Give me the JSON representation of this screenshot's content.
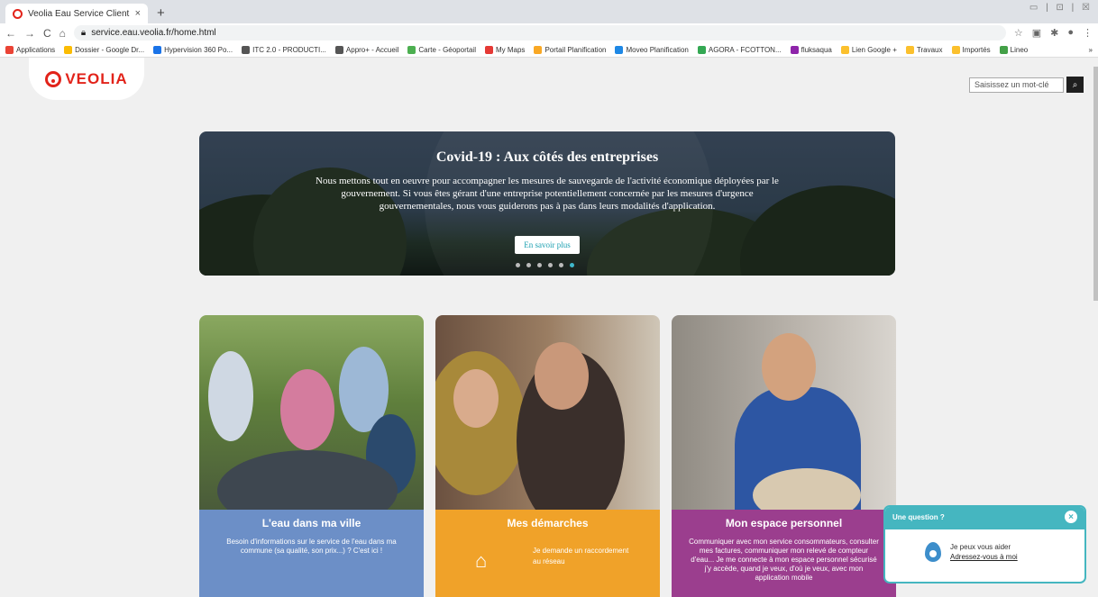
{
  "browser": {
    "tab_title": "Veolia Eau Service Client",
    "tab_close": "×",
    "new_tab": "+",
    "url": "service.eau.veolia.fr/home.html",
    "window_controls": "▭ | ⊡ | ☒",
    "bookmarks": [
      {
        "label": "Applications",
        "color": "#ea4335"
      },
      {
        "label": "Dossier - Google Dr...",
        "color": "#fbbc04"
      },
      {
        "label": "Hypervision 360 Po...",
        "color": "#1a73e8"
      },
      {
        "label": "ITC 2.0 - PRODUCTI...",
        "color": "#555555"
      },
      {
        "label": "Appro+ - Accueil",
        "color": "#555555"
      },
      {
        "label": "Carte - Géoportail",
        "color": "#4caf50"
      },
      {
        "label": "My Maps",
        "color": "#e53935"
      },
      {
        "label": "Portail Planification",
        "color": "#f9a825"
      },
      {
        "label": "Moveo Planification",
        "color": "#1e88e5"
      },
      {
        "label": "AGORA - FCOTTON...",
        "color": "#34a853"
      },
      {
        "label": "fluksaqua",
        "color": "#8e24aa"
      },
      {
        "label": "Lien Google +",
        "color": "#fbc02d"
      },
      {
        "label": "Travaux",
        "color": "#fbc02d"
      },
      {
        "label": "Importés",
        "color": "#fbc02d"
      },
      {
        "label": "Lineo",
        "color": "#43a047"
      }
    ],
    "more_bookmarks": "»"
  },
  "header": {
    "logo_text": "VEOLIA",
    "search_placeholder": "Saisissez un mot-clé",
    "search_button_icon": "⌕"
  },
  "banner": {
    "title": "Covid-19 : Aux côtés des entreprises",
    "text": "Nous mettons tout en oeuvre pour accompagner les mesures de sauvegarde de l'activité économique déployées par le gouvernement. Si vous êtes gérant d'une entreprise potentiellement concernée par les mesures d'urgence gouvernementales, nous vous guiderons pas à pas dans leurs modalités d'application.",
    "button": "En savoir plus",
    "dot_count": 6,
    "active_dot": 6
  },
  "cards": [
    {
      "title": "L'eau dans ma ville",
      "text": "Besoin d'informations sur le service de l'eau dans ma commune (sa qualité, son prix...) ? C'est ici !"
    },
    {
      "title": "Mes démarches",
      "text": "Je demande un raccordement au réseau"
    },
    {
      "title": "Mon espace personnel",
      "text": "Communiquer avec mon service consommateurs, consulter mes factures, communiquer mon relevé de compteur d'eau... Je me connecte à mon espace personnel sécurisé j'y accède, quand je veux, d'où je veux, avec mon application mobile"
    }
  ],
  "chat": {
    "title": "Une question ?",
    "line1": "Je peux vous aider",
    "link": "Adressez-vous à moi"
  }
}
